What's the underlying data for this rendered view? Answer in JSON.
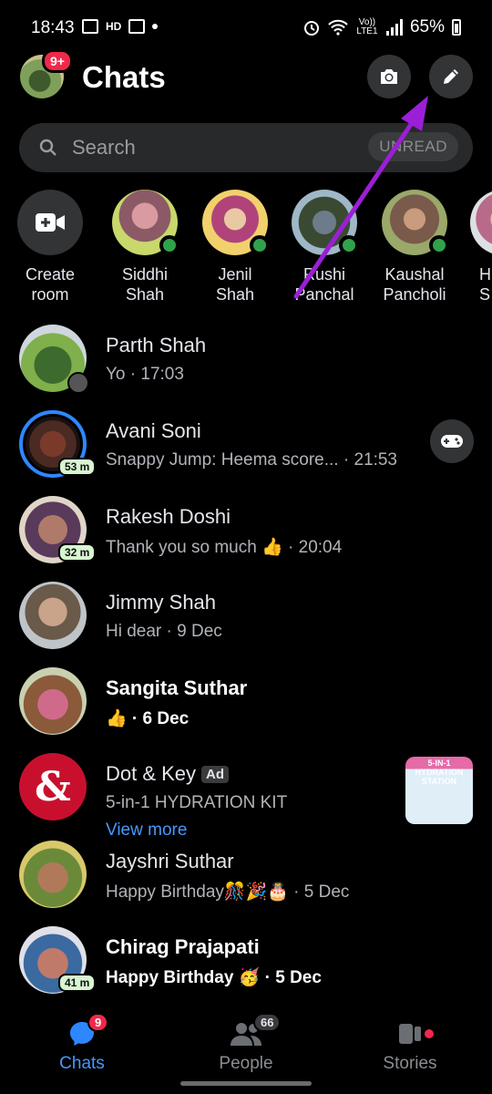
{
  "status_bar": {
    "time": "18:43",
    "hd_label": "HD",
    "volte_label": "Vo)) LTE1",
    "battery": "65%"
  },
  "header": {
    "title": "Chats",
    "my_badge": "9+"
  },
  "search": {
    "placeholder": "Search",
    "filter_label": "UNREAD"
  },
  "stories": [
    {
      "name": "Create\nroom"
    },
    {
      "name": "Siddhi\nShah"
    },
    {
      "name": "Jenil\nShah"
    },
    {
      "name": "Rushi\nPanchal"
    },
    {
      "name": "Kaushal\nPancholi"
    },
    {
      "name": "H\nS"
    }
  ],
  "chats": [
    {
      "name": "Parth Shah",
      "preview": "Yo · 17:03",
      "badge": ""
    },
    {
      "name": "Avani Soni",
      "preview": "Snappy Jump: Heema score... · 21:53",
      "badge": "53 m"
    },
    {
      "name": "Rakesh Doshi",
      "preview": "Thank you so much 👍 · 20:04",
      "badge": "32 m"
    },
    {
      "name": "Jimmy Shah",
      "preview": "Hi dear · 9 Dec",
      "badge": ""
    },
    {
      "name": "Sangita Suthar",
      "preview": "👍 · 6 Dec",
      "badge": ""
    },
    {
      "name": "Dot & Key",
      "ad_label": "Ad",
      "preview": "5-in-1 HYDRATION KIT",
      "link": "View more",
      "ad_image_text": "5-IN-1 HYDRATION STATION"
    },
    {
      "name": "Jayshri Suthar",
      "preview": "Happy Birthday🎊🎉🎂 · 5 Dec",
      "badge": ""
    },
    {
      "name": "Chirag Prajapati",
      "preview": "Happy Birthday 🥳 · 5 Dec",
      "badge": "41 m"
    }
  ],
  "bottom_nav": {
    "chats_label": "Chats",
    "chats_badge": "9",
    "people_label": "People",
    "people_badge": "66",
    "stories_label": "Stories"
  },
  "colors": {
    "accent": "#4599ff",
    "badge_red": "#f02849",
    "online_green": "#31a24c",
    "annotation_arrow": "#9b1fd6"
  },
  "icons": [
    "camera-icon",
    "pencil-icon",
    "search-icon",
    "video-plus-icon",
    "gamepad-icon",
    "chat-bubble-icon",
    "people-icon",
    "stories-icon"
  ]
}
